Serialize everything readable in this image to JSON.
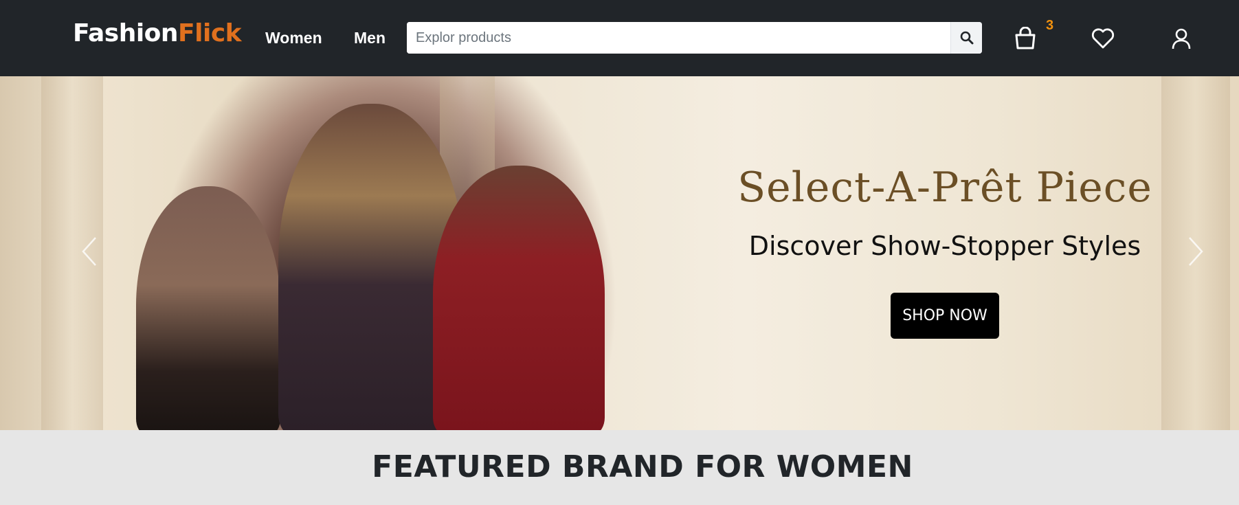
{
  "brand": {
    "part1": "Fashion",
    "part2": "Flick"
  },
  "nav": {
    "women": "Women",
    "men": "Men"
  },
  "search": {
    "placeholder": "Explor products",
    "icon": "search-icon"
  },
  "header_icons": {
    "cart": "shopping-bag-icon",
    "cart_count": "3",
    "wishlist": "heart-icon",
    "account": "user-icon"
  },
  "hero": {
    "title": "Select-A-Prêt Piece",
    "subtitle": "Discover Show-Stopper Styles",
    "cta": "SHOP NOW",
    "prev_icon": "chevron-left-icon",
    "next_icon": "chevron-right-icon"
  },
  "featured": {
    "heading": "FEATURED BRAND FOR WOMEN"
  },
  "colors": {
    "navbar": "#212529",
    "brand_accent": "#e0701e",
    "badge": "#f0900e",
    "hero_title": "#6b4f26",
    "section_bg": "#e6e6e6"
  }
}
